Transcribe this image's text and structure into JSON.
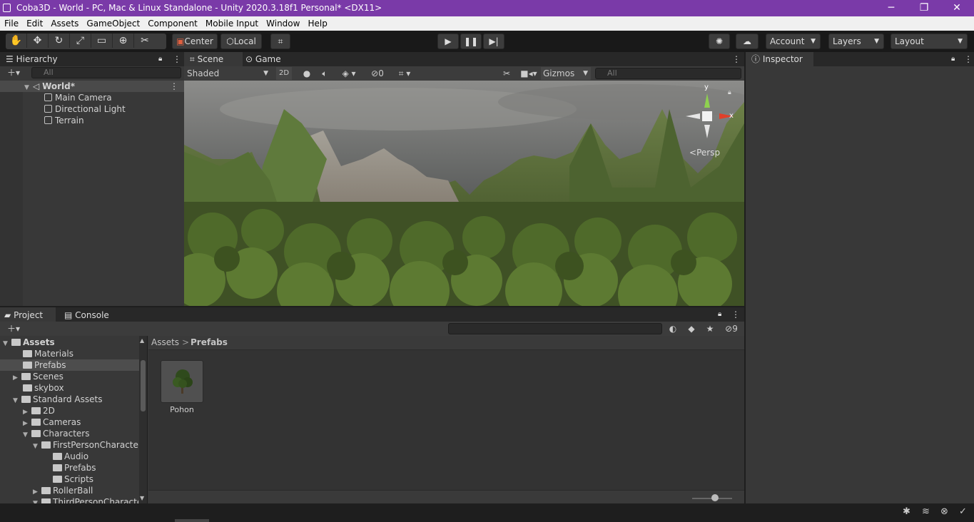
{
  "titlebar": {
    "title": "Coba3D - World - PC, Mac & Linux Standalone - Unity 2020.3.18f1 Personal* <DX11>",
    "minimize": "─",
    "restore": "❐",
    "close": "✕"
  },
  "menu": [
    "File",
    "Edit",
    "Assets",
    "GameObject",
    "Component",
    "Mobile Input",
    "Window",
    "Help"
  ],
  "toolbar": {
    "pivot": "Center",
    "space": "Local",
    "account": "Account",
    "layers": "Layers",
    "layout": "Layout"
  },
  "hierarchy": {
    "tab": "Hierarchy",
    "search_placeholder": "All",
    "scene": "World*",
    "items": [
      "Main Camera",
      "Directional Light",
      "Terrain"
    ]
  },
  "scene": {
    "tab_scene": "Scene",
    "tab_game": "Game",
    "shading": "Shaded",
    "mode2d": "2D",
    "hidden_count": "0",
    "gizmos": "Gizmos",
    "search_placeholder": "All",
    "persp": "Persp",
    "axis_y": "y",
    "axis_x": "x"
  },
  "inspector": {
    "tab": "Inspector"
  },
  "project": {
    "tab_project": "Project",
    "tab_console": "Console",
    "hidden_count": "9",
    "breadcrumb_root": "Assets",
    "breadcrumb_sep": ">",
    "breadcrumb_current": "Prefabs",
    "tree": [
      {
        "label": "Assets",
        "bold": true
      },
      {
        "label": "Materials"
      },
      {
        "label": "Prefabs"
      },
      {
        "label": "Scenes"
      },
      {
        "label": "skybox"
      },
      {
        "label": "Standard Assets"
      },
      {
        "label": "2D"
      },
      {
        "label": "Cameras"
      },
      {
        "label": "Characters"
      },
      {
        "label": "FirstPersonCharacter"
      },
      {
        "label": "Audio"
      },
      {
        "label": "Prefabs"
      },
      {
        "label": "Scripts"
      },
      {
        "label": "RollerBall"
      },
      {
        "label": "ThirdPersonCharacter"
      }
    ],
    "asset_name": "Pohon"
  }
}
